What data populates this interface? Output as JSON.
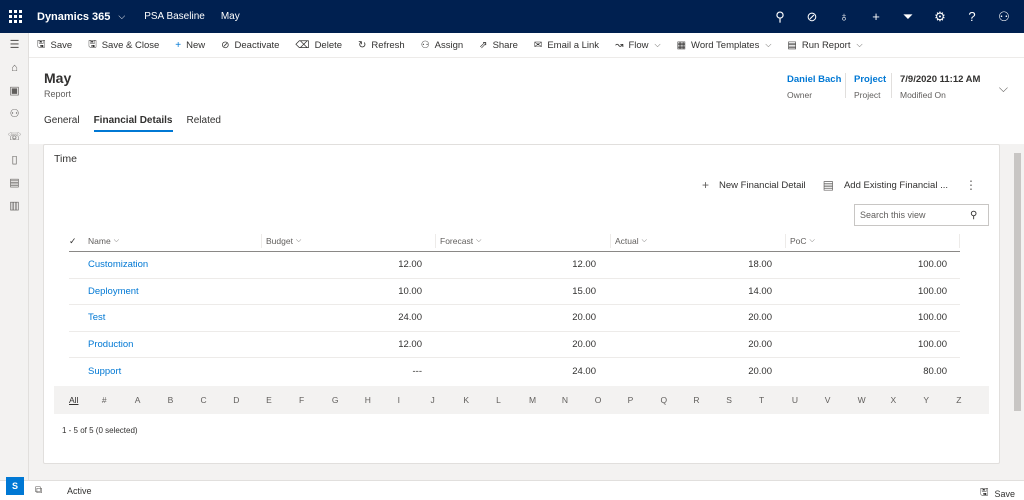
{
  "topbar": {
    "app_name": "Dynamics 365",
    "breadcrumb_app": "PSA Baseline",
    "breadcrumb_record": "May"
  },
  "commands": [
    {
      "label": "Save",
      "icon": "save-icon",
      "glyph": "🖫"
    },
    {
      "label": "Save & Close",
      "icon": "save-close-icon",
      "glyph": "🖫"
    },
    {
      "label": "New",
      "icon": "plus-icon",
      "glyph": "+"
    },
    {
      "label": "Deactivate",
      "icon": "deactivate-icon",
      "glyph": "⊘"
    },
    {
      "label": "Delete",
      "icon": "trash-icon",
      "glyph": "🗑"
    },
    {
      "label": "Refresh",
      "icon": "refresh-icon",
      "glyph": "↻"
    },
    {
      "label": "Assign",
      "icon": "assign-icon",
      "glyph": "👤"
    },
    {
      "label": "Share",
      "icon": "share-icon",
      "glyph": "⇗"
    },
    {
      "label": "Email a Link",
      "icon": "email-icon",
      "glyph": "✉"
    },
    {
      "label": "Flow",
      "icon": "flow-icon",
      "glyph": "↝"
    },
    {
      "label": "Word Templates",
      "icon": "word-templates-icon",
      "glyph": "▦"
    },
    {
      "label": "Run Report",
      "icon": "report-icon",
      "glyph": "▤"
    }
  ],
  "record": {
    "title": "May",
    "type": "Report",
    "owner_value": "Daniel Bach",
    "owner_label": "Owner",
    "project_value": "Project",
    "project_label": "Project",
    "modified_value": "7/9/2020 11:12 AM",
    "modified_label": "Modified On"
  },
  "tabs": [
    {
      "label": "General",
      "active": false
    },
    {
      "label": "Financial Details",
      "active": true
    },
    {
      "label": "Related",
      "active": false
    }
  ],
  "section": {
    "title": "Time",
    "new_button": "New Financial Detail",
    "add_existing_button": "Add Existing Financial ...",
    "search_placeholder": "Search this view"
  },
  "grid": {
    "columns": [
      "Name",
      "Budget",
      "Forecast",
      "Actual",
      "PoC"
    ],
    "rows": [
      [
        "Customization",
        "12.00",
        "12.00",
        "18.00",
        "100.00"
      ],
      [
        "Deployment",
        "10.00",
        "15.00",
        "14.00",
        "100.00"
      ],
      [
        "Test",
        "24.00",
        "20.00",
        "20.00",
        "100.00"
      ],
      [
        "Production",
        "12.00",
        "20.00",
        "20.00",
        "100.00"
      ],
      [
        "Support",
        "---",
        "24.00",
        "20.00",
        "80.00"
      ]
    ],
    "jump_letters": [
      "All",
      "#",
      "A",
      "B",
      "C",
      "D",
      "E",
      "F",
      "G",
      "H",
      "I",
      "J",
      "K",
      "L",
      "M",
      "N",
      "O",
      "P",
      "Q",
      "R",
      "S",
      "T",
      "U",
      "V",
      "W",
      "X",
      "Y",
      "Z"
    ],
    "record_count": "1 - 5 of 5 (0 selected)"
  },
  "footer": {
    "avatar": "S",
    "status": "Active",
    "save": "Save"
  },
  "colors": {
    "nav_bg": "#002050",
    "accent": "#0078d4"
  }
}
